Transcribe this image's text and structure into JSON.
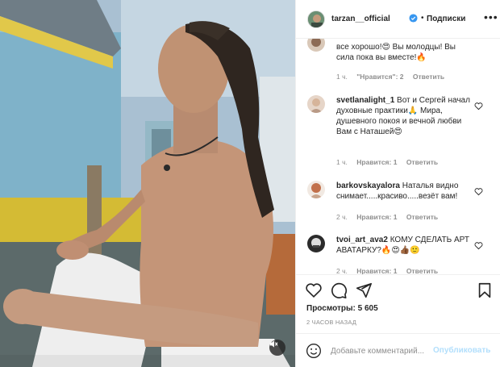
{
  "header": {
    "username": "tarzan__official",
    "separator": "•",
    "follow_label": "Подписки",
    "more_icon": "more-icon"
  },
  "comments": [
    {
      "username": "",
      "text": "все хорошо!😍 Вы молодцы! Вы сила пока вы вместе!🔥",
      "time": "1 ч.",
      "likes": "\"Нравится\": 2",
      "reply": "Ответить"
    },
    {
      "username": "svetlanalight_1",
      "text": "Вот и Сергей начал духовные практики🙏 Мира, душевного покоя и вечной любви Вам с Наташей😍",
      "time": "1 ч.",
      "likes": "Нравится: 1",
      "reply": "Ответить"
    },
    {
      "username": "barkovskayalora",
      "text": "Наталья видно снимает.....красиво.....везёт вам!",
      "time": "2 ч.",
      "likes": "Нравится: 1",
      "reply": "Ответить"
    },
    {
      "username": "tvoi_art_ava2",
      "text": "КОМУ СДЕЛАТЬ АРТ АВАТАРКУ?🔥😍👍🏾🙂",
      "time": "2 ч.",
      "likes": "Нравится: 1",
      "reply": "Ответить"
    }
  ],
  "stats": {
    "views_label": "Просмотры:",
    "views_count": "5 605",
    "time_ago": "2 ЧАСОВ НАЗАД"
  },
  "composer": {
    "placeholder": "Добавьте комментарий...",
    "post_label": "Опубликовать"
  },
  "colors": {
    "verified": "#3897f0",
    "muted_text": "#8e8e8e",
    "post_disabled": "#b2dffc",
    "divider": "#efefef"
  }
}
